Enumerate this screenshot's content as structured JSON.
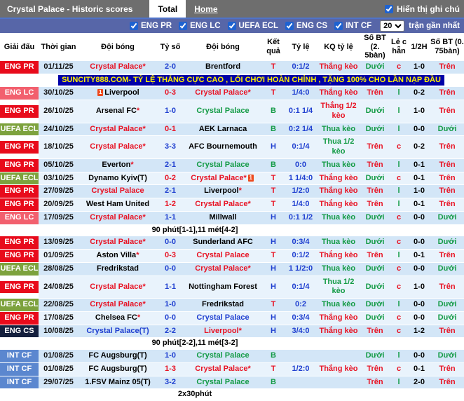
{
  "titlebar": {
    "title": "Crystal Palace - Historic scores",
    "tabs": [
      {
        "label": "Total",
        "active": true
      },
      {
        "label": "Home",
        "active": false
      }
    ],
    "note_toggle_label": "Hiển thị ghi chú",
    "note_toggle_checked": true
  },
  "filterbar": {
    "leagues": [
      "ENG PR",
      "ENG LC",
      "UEFA ECL",
      "ENG CS",
      "INT CF"
    ],
    "all_checked": true,
    "count_value": "20",
    "count_suffix": "trận gần nhất"
  },
  "table": {
    "headers": [
      "Giải đấu",
      "Thời gian",
      "Đội bóng",
      "Tỷ số",
      "Đội bóng",
      "Kết quả",
      "Tỷ lệ",
      "KQ tỷ lệ",
      "Số BT (2. 5bàn)",
      "Lẻ c hẵn",
      "1/2H",
      "Số BT (0. 75bàn)"
    ],
    "league_colors": {
      "ENG PR": "#e80b1b",
      "ENG LC": "#f2606e",
      "UEFA ECL": "#7da23d",
      "ENG CS": "#141f3d",
      "INT CF": "#5b87cf"
    },
    "rows": [
      {
        "type": "match",
        "league": "ENG PR",
        "date": "01/11/25",
        "home": {
          "name": "Crystal Palace*",
          "color": "red"
        },
        "score": {
          "text": "2-0",
          "color": "blue"
        },
        "away": {
          "name": "Brentford",
          "color": "black"
        },
        "result": {
          "text": "T",
          "color": "red"
        },
        "odds": "0:1/2",
        "odds_result": {
          "text": "Thắng kèo",
          "color": "red"
        },
        "ou25": {
          "text": "Dưới",
          "color": "green"
        },
        "odd_even": {
          "text": "c",
          "color": "red"
        },
        "half": "1-0",
        "ou075": {
          "text": "Trên",
          "color": "red"
        }
      },
      {
        "type": "banner",
        "text": "SUNCITY888.COM- TỶ LỆ THẮNG CỰC CAO , LỐI CHƠI HOÀN CHỈNH , TẶNG 100% CHO LẦN NẠP ĐẦU"
      },
      {
        "type": "match",
        "league": "ENG LC",
        "date": "30/10/25",
        "home": {
          "name": "Liverpool",
          "color": "black",
          "card": "left"
        },
        "score": {
          "text": "0-3",
          "color": "red"
        },
        "away": {
          "name": "Crystal Palace*",
          "color": "red"
        },
        "result": {
          "text": "T",
          "color": "red"
        },
        "odds": "1/4:0",
        "odds_result": {
          "text": "Thắng kèo",
          "color": "red"
        },
        "ou25": {
          "text": "Trên",
          "color": "red"
        },
        "odd_even": {
          "text": "l",
          "color": "green"
        },
        "half": "0-2",
        "ou075": {
          "text": "Trên",
          "color": "red"
        }
      },
      {
        "type": "match",
        "league": "ENG PR",
        "date": "26/10/25",
        "home": {
          "name": "Arsenal FC*",
          "color": "black"
        },
        "score": {
          "text": "1-0",
          "color": "blue"
        },
        "away": {
          "name": "Crystal Palace",
          "color": "green"
        },
        "result": {
          "text": "B",
          "color": "green"
        },
        "odds": "0:1 1/4",
        "odds_result": {
          "text": "Thắng 1/2 kèo",
          "color": "red"
        },
        "ou25": {
          "text": "Dưới",
          "color": "green"
        },
        "odd_even": {
          "text": "l",
          "color": "green"
        },
        "half": "1-0",
        "ou075": {
          "text": "Trên",
          "color": "red"
        }
      },
      {
        "type": "match",
        "league": "UEFA ECL",
        "date": "24/10/25",
        "home": {
          "name": "Crystal Palace*",
          "color": "red"
        },
        "score": {
          "text": "0-1",
          "color": "red"
        },
        "away": {
          "name": "AEK Larnaca",
          "color": "black"
        },
        "result": {
          "text": "B",
          "color": "green"
        },
        "odds": "0:2 1/4",
        "odds_result": {
          "text": "Thua kèo",
          "color": "green"
        },
        "ou25": {
          "text": "Dưới",
          "color": "green"
        },
        "odd_even": {
          "text": "l",
          "color": "green"
        },
        "half": "0-0",
        "ou075": {
          "text": "Dưới",
          "color": "green"
        }
      },
      {
        "type": "match",
        "league": "ENG PR",
        "date": "18/10/25",
        "home": {
          "name": "Crystal Palace*",
          "color": "red"
        },
        "score": {
          "text": "3-3",
          "color": "blue"
        },
        "away": {
          "name": "AFC Bournemouth",
          "color": "black"
        },
        "result": {
          "text": "H",
          "color": "blue"
        },
        "odds": "0:1/4",
        "odds_result": {
          "text": "Thua 1/2 kèo",
          "color": "green"
        },
        "ou25": {
          "text": "Trên",
          "color": "red"
        },
        "odd_even": {
          "text": "c",
          "color": "red"
        },
        "half": "0-2",
        "ou075": {
          "text": "Trên",
          "color": "red"
        }
      },
      {
        "type": "match",
        "league": "ENG PR",
        "date": "05/10/25",
        "home": {
          "name": "Everton*",
          "color": "black"
        },
        "score": {
          "text": "2-1",
          "color": "blue"
        },
        "away": {
          "name": "Crystal Palace",
          "color": "green"
        },
        "result": {
          "text": "B",
          "color": "green"
        },
        "odds": "0:0",
        "odds_result": {
          "text": "Thua kèo",
          "color": "green"
        },
        "ou25": {
          "text": "Trên",
          "color": "red"
        },
        "odd_even": {
          "text": "l",
          "color": "green"
        },
        "half": "0-1",
        "ou075": {
          "text": "Trên",
          "color": "red"
        }
      },
      {
        "type": "match",
        "league": "UEFA ECL",
        "date": "03/10/25",
        "home": {
          "name": "Dynamo Kyiv(T)",
          "color": "black"
        },
        "score": {
          "text": "0-2",
          "color": "red"
        },
        "away": {
          "name": "Crystal Palace*",
          "color": "red",
          "card": "right"
        },
        "result": {
          "text": "T",
          "color": "red"
        },
        "odds": "1 1/4:0",
        "odds_result": {
          "text": "Thắng kèo",
          "color": "red"
        },
        "ou25": {
          "text": "Dưới",
          "color": "green"
        },
        "odd_even": {
          "text": "c",
          "color": "red"
        },
        "half": "0-1",
        "ou075": {
          "text": "Trên",
          "color": "red"
        }
      },
      {
        "type": "match",
        "league": "ENG PR",
        "date": "27/09/25",
        "home": {
          "name": "Crystal Palace",
          "color": "red"
        },
        "score": {
          "text": "2-1",
          "color": "blue"
        },
        "away": {
          "name": "Liverpool*",
          "color": "black"
        },
        "result": {
          "text": "T",
          "color": "red"
        },
        "odds": "1/2:0",
        "odds_result": {
          "text": "Thắng kèo",
          "color": "red"
        },
        "ou25": {
          "text": "Trên",
          "color": "red"
        },
        "odd_even": {
          "text": "l",
          "color": "green"
        },
        "half": "1-0",
        "ou075": {
          "text": "Trên",
          "color": "red"
        }
      },
      {
        "type": "match",
        "league": "ENG PR",
        "date": "20/09/25",
        "home": {
          "name": "West Ham United",
          "color": "black"
        },
        "score": {
          "text": "1-2",
          "color": "red"
        },
        "away": {
          "name": "Crystal Palace*",
          "color": "red"
        },
        "result": {
          "text": "T",
          "color": "red"
        },
        "odds": "1/4:0",
        "odds_result": {
          "text": "Thắng kèo",
          "color": "red"
        },
        "ou25": {
          "text": "Trên",
          "color": "red"
        },
        "odd_even": {
          "text": "l",
          "color": "green"
        },
        "half": "0-1",
        "ou075": {
          "text": "Trên",
          "color": "red"
        }
      },
      {
        "type": "match",
        "league": "ENG LC",
        "date": "17/09/25",
        "home": {
          "name": "Crystal Palace*",
          "color": "red"
        },
        "score": {
          "text": "1-1",
          "color": "blue"
        },
        "away": {
          "name": "Millwall",
          "color": "black"
        },
        "result": {
          "text": "H",
          "color": "blue"
        },
        "odds": "0:1 1/2",
        "odds_result": {
          "text": "Thua kèo",
          "color": "green"
        },
        "ou25": {
          "text": "Dưới",
          "color": "green"
        },
        "odd_even": {
          "text": "c",
          "color": "red"
        },
        "half": "0-0",
        "ou075": {
          "text": "Dưới",
          "color": "green"
        }
      },
      {
        "type": "note",
        "text": "90 phút[1-1],11 mét[4-2]"
      },
      {
        "type": "match",
        "league": "ENG PR",
        "date": "13/09/25",
        "home": {
          "name": "Crystal Palace*",
          "color": "red"
        },
        "score": {
          "text": "0-0",
          "color": "blue"
        },
        "away": {
          "name": "Sunderland AFC",
          "color": "black"
        },
        "result": {
          "text": "H",
          "color": "blue"
        },
        "odds": "0:3/4",
        "odds_result": {
          "text": "Thua kèo",
          "color": "green"
        },
        "ou25": {
          "text": "Dưới",
          "color": "green"
        },
        "odd_even": {
          "text": "c",
          "color": "red"
        },
        "half": "0-0",
        "ou075": {
          "text": "Dưới",
          "color": "green"
        }
      },
      {
        "type": "match",
        "league": "ENG PR",
        "date": "01/09/25",
        "home": {
          "name": "Aston Villa*",
          "color": "black"
        },
        "score": {
          "text": "0-3",
          "color": "red"
        },
        "away": {
          "name": "Crystal Palace",
          "color": "red"
        },
        "result": {
          "text": "T",
          "color": "red"
        },
        "odds": "0:1/2",
        "odds_result": {
          "text": "Thắng kèo",
          "color": "red"
        },
        "ou25": {
          "text": "Trên",
          "color": "red"
        },
        "odd_even": {
          "text": "l",
          "color": "green"
        },
        "half": "0-1",
        "ou075": {
          "text": "Trên",
          "color": "red"
        }
      },
      {
        "type": "match",
        "league": "UEFA ECL",
        "date": "28/08/25",
        "home": {
          "name": "Fredrikstad",
          "color": "black"
        },
        "score": {
          "text": "0-0",
          "color": "blue"
        },
        "away": {
          "name": "Crystal Palace*",
          "color": "red"
        },
        "result": {
          "text": "H",
          "color": "blue"
        },
        "odds": "1 1/2:0",
        "odds_result": {
          "text": "Thua kèo",
          "color": "green"
        },
        "ou25": {
          "text": "Dưới",
          "color": "green"
        },
        "odd_even": {
          "text": "c",
          "color": "red"
        },
        "half": "0-0",
        "ou075": {
          "text": "Dưới",
          "color": "green"
        }
      },
      {
        "type": "match",
        "league": "ENG PR",
        "date": "24/08/25",
        "home": {
          "name": "Crystal Palace*",
          "color": "red"
        },
        "score": {
          "text": "1-1",
          "color": "blue"
        },
        "away": {
          "name": "Nottingham Forest",
          "color": "black"
        },
        "result": {
          "text": "H",
          "color": "blue"
        },
        "odds": "0:1/4",
        "odds_result": {
          "text": "Thua 1/2 kèo",
          "color": "green"
        },
        "ou25": {
          "text": "Dưới",
          "color": "green"
        },
        "odd_even": {
          "text": "c",
          "color": "red"
        },
        "half": "1-0",
        "ou075": {
          "text": "Trên",
          "color": "red"
        }
      },
      {
        "type": "match",
        "league": "UEFA ECL",
        "date": "22/08/25",
        "home": {
          "name": "Crystal Palace*",
          "color": "red"
        },
        "score": {
          "text": "1-0",
          "color": "blue"
        },
        "away": {
          "name": "Fredrikstad",
          "color": "black"
        },
        "result": {
          "text": "T",
          "color": "red"
        },
        "odds": "0:2",
        "odds_result": {
          "text": "Thua kèo",
          "color": "green"
        },
        "ou25": {
          "text": "Dưới",
          "color": "green"
        },
        "odd_even": {
          "text": "l",
          "color": "green"
        },
        "half": "0-0",
        "ou075": {
          "text": "Dưới",
          "color": "green"
        }
      },
      {
        "type": "match",
        "league": "ENG PR",
        "date": "17/08/25",
        "home": {
          "name": "Chelsea FC*",
          "color": "black"
        },
        "score": {
          "text": "0-0",
          "color": "blue"
        },
        "away": {
          "name": "Crystal Palace",
          "color": "blue"
        },
        "result": {
          "text": "H",
          "color": "blue"
        },
        "odds": "0:3/4",
        "odds_result": {
          "text": "Thắng kèo",
          "color": "red"
        },
        "ou25": {
          "text": "Dưới",
          "color": "green"
        },
        "odd_even": {
          "text": "c",
          "color": "red"
        },
        "half": "0-0",
        "ou075": {
          "text": "Dưới",
          "color": "green"
        }
      },
      {
        "type": "match",
        "league": "ENG CS",
        "date": "10/08/25",
        "home": {
          "name": "Crystal Palace(T)",
          "color": "blue"
        },
        "score": {
          "text": "2-2",
          "color": "blue"
        },
        "away": {
          "name": "Liverpool*",
          "color": "red"
        },
        "result": {
          "text": "H",
          "color": "blue"
        },
        "odds": "3/4:0",
        "odds_result": {
          "text": "Thắng kèo",
          "color": "red"
        },
        "ou25": {
          "text": "Trên",
          "color": "red"
        },
        "odd_even": {
          "text": "c",
          "color": "red"
        },
        "half": "1-2",
        "ou075": {
          "text": "Trên",
          "color": "red"
        }
      },
      {
        "type": "note",
        "text": "90 phút[2-2],11 mét[3-2]"
      },
      {
        "type": "match",
        "league": "INT CF",
        "date": "01/08/25",
        "home": {
          "name": "FC Augsburg(T)",
          "color": "black"
        },
        "score": {
          "text": "1-0",
          "color": "blue"
        },
        "away": {
          "name": "Crystal Palace",
          "color": "green"
        },
        "result": {
          "text": "B",
          "color": "green"
        },
        "odds": "",
        "odds_result": {
          "text": "",
          "color": "black"
        },
        "ou25": {
          "text": "Dưới",
          "color": "green"
        },
        "odd_even": {
          "text": "l",
          "color": "green"
        },
        "half": "0-0",
        "ou075": {
          "text": "Dưới",
          "color": "green"
        }
      },
      {
        "type": "match",
        "league": "INT CF",
        "date": "01/08/25",
        "home": {
          "name": "FC Augsburg(T)",
          "color": "black"
        },
        "score": {
          "text": "1-3",
          "color": "red"
        },
        "away": {
          "name": "Crystal Palace*",
          "color": "red"
        },
        "result": {
          "text": "T",
          "color": "red"
        },
        "odds": "1/2:0",
        "odds_result": {
          "text": "Thắng kèo",
          "color": "red"
        },
        "ou25": {
          "text": "Trên",
          "color": "red"
        },
        "odd_even": {
          "text": "c",
          "color": "red"
        },
        "half": "0-1",
        "ou075": {
          "text": "Trên",
          "color": "red"
        }
      },
      {
        "type": "match",
        "league": "INT CF",
        "date": "29/07/25",
        "home": {
          "name": "1.FSV Mainz 05(T)",
          "color": "black"
        },
        "score": {
          "text": "3-2",
          "color": "blue"
        },
        "away": {
          "name": "Crystal Palace",
          "color": "green"
        },
        "result": {
          "text": "B",
          "color": "green"
        },
        "odds": "",
        "odds_result": {
          "text": "",
          "color": "black"
        },
        "ou25": {
          "text": "Trên",
          "color": "red"
        },
        "odd_even": {
          "text": "l",
          "color": "green"
        },
        "half": "2-0",
        "ou075": {
          "text": "Trên",
          "color": "red"
        }
      },
      {
        "type": "note",
        "text": "2x30phút"
      }
    ]
  }
}
